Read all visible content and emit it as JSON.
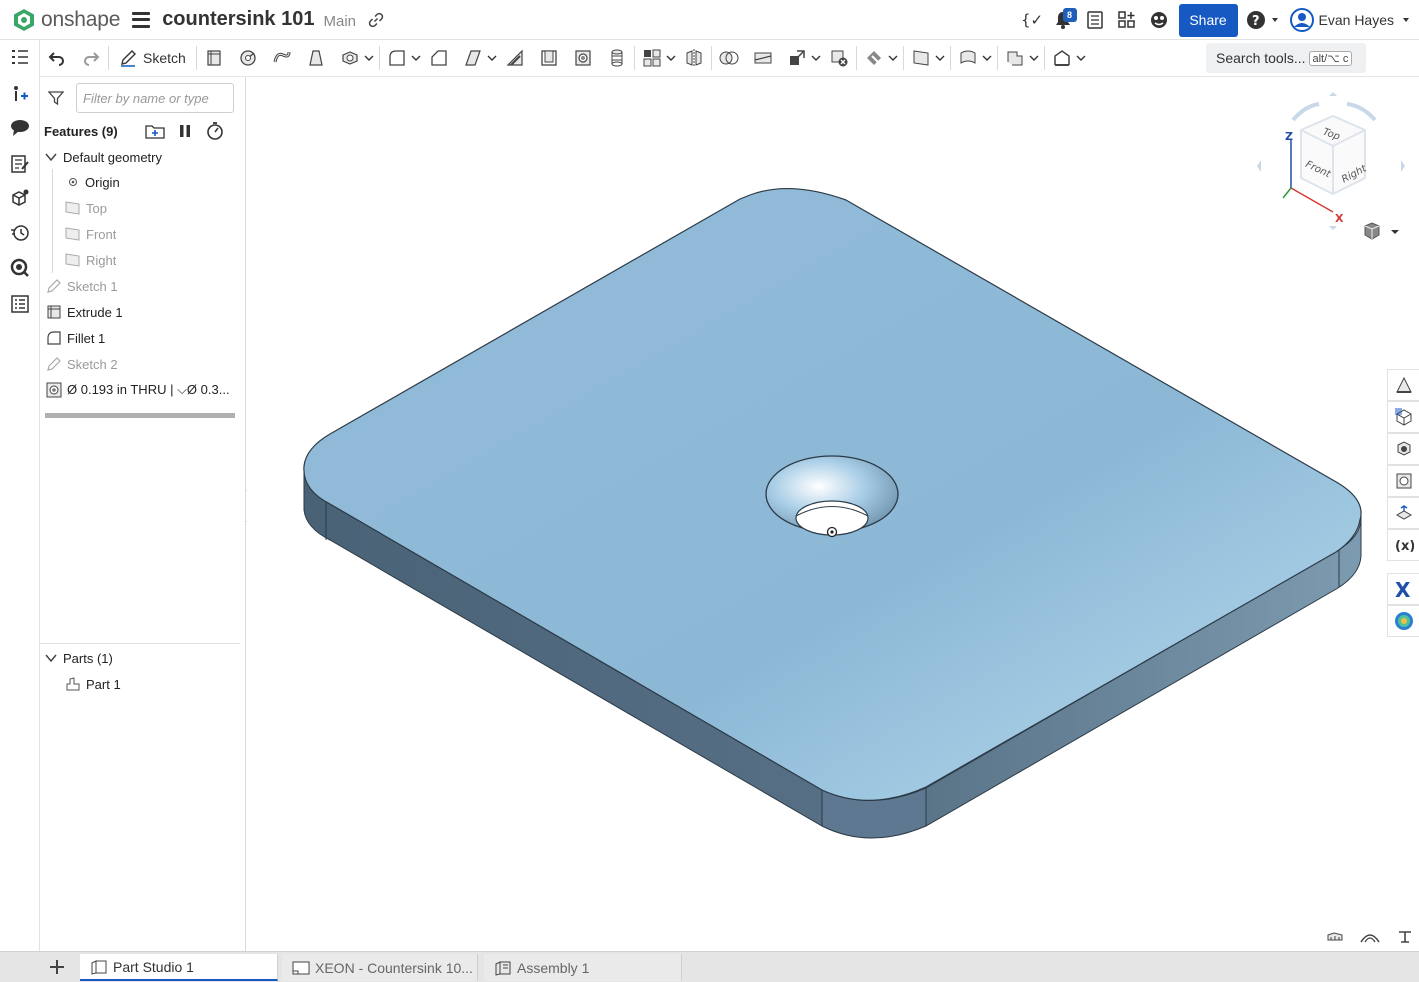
{
  "header": {
    "brand": "onshape",
    "document_title": "countersink 101",
    "branch": "Main",
    "notification_count": "8",
    "share_label": "Share",
    "user_name": "Evan Hayes"
  },
  "toolbar": {
    "sketch_label": "Sketch",
    "search_label": "Search tools...",
    "search_shortcut": "alt/⌥ c"
  },
  "feature_panel": {
    "filter_placeholder": "Filter by name or type",
    "features_title": "Features (9)",
    "default_geometry_label": "Default geometry",
    "default_geometry": [
      "Origin",
      "Top",
      "Front",
      "Right"
    ],
    "features": [
      {
        "label": "Sketch 1",
        "icon": "sketch-icon",
        "suppressed_look": true
      },
      {
        "label": "Extrude 1",
        "icon": "extrude-icon",
        "suppressed_look": false
      },
      {
        "label": "Fillet 1",
        "icon": "fillet-icon",
        "suppressed_look": false
      },
      {
        "label": "Sketch 2",
        "icon": "sketch-icon",
        "suppressed_look": true
      },
      {
        "label": "Ø 0.193 in THRU | ⌵Ø 0.3...",
        "icon": "hole-icon",
        "suppressed_look": false
      }
    ],
    "parts_title": "Parts (1)",
    "parts": [
      "Part 1"
    ]
  },
  "view_cube": {
    "faces": [
      "Top",
      "Front",
      "Right"
    ],
    "axes": [
      "Z",
      "X"
    ]
  },
  "tabs": [
    {
      "label": "Part Studio 1",
      "active": true
    },
    {
      "label": "XEON - Countersink 10...",
      "active": false
    },
    {
      "label": "Assembly 1",
      "active": false
    }
  ],
  "colors": {
    "accent": "#1659c2",
    "part_top": "#8fb9d6",
    "part_side": "#4f6a80",
    "brand_green": "#3aa66a"
  }
}
